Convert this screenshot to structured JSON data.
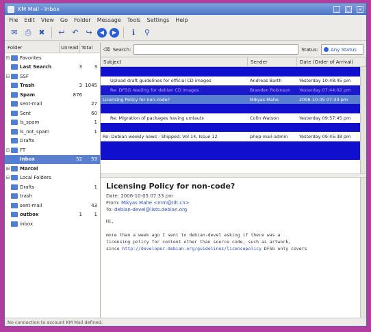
{
  "window": {
    "title": "KM Mail - Inbox"
  },
  "menu": [
    "File",
    "Edit",
    "View",
    "Go",
    "Folder",
    "Message",
    "Tools",
    "Settings",
    "Help"
  ],
  "toolbar": {
    "icons": [
      "new-message-icon",
      "print-icon",
      "trash-icon",
      "reply-icon",
      "reply-all-icon",
      "forward-icon",
      "previous-icon",
      "next-icon",
      "info-icon",
      "find-icon"
    ]
  },
  "folder_pane": {
    "headers": {
      "name": "Folder",
      "unread": "Unread",
      "total": "Total"
    },
    "items": [
      {
        "name": "Favorites",
        "unread": "",
        "total": ""
      },
      {
        "name": "Last Search",
        "unread": "3",
        "total": "3"
      },
      {
        "name": "SSF",
        "unread": "",
        "total": ""
      },
      {
        "name": "Trash",
        "unread": "3",
        "total": "1045"
      },
      {
        "name": "Spam",
        "unread": "876",
        "total": ""
      },
      {
        "name": "sent-mail",
        "unread": "",
        "total": "27"
      },
      {
        "name": "Sent",
        "unread": "",
        "total": "60"
      },
      {
        "name": "ls_spam",
        "unread": "",
        "total": "1"
      },
      {
        "name": "ls_not_spam",
        "unread": "",
        "total": "1"
      },
      {
        "name": "Drafts",
        "unread": "",
        "total": ""
      },
      {
        "name": "FT",
        "unread": "",
        "total": ""
      },
      {
        "name": "Inbox",
        "unread": "52",
        "total": "53"
      },
      {
        "name": "Marcel",
        "unread": "",
        "total": ""
      },
      {
        "name": "Local Folders",
        "unread": "",
        "total": ""
      },
      {
        "name": "Drafts",
        "unread": "",
        "total": "1"
      },
      {
        "name": "trash",
        "unread": "",
        "total": ""
      },
      {
        "name": "sent-mail",
        "unread": "",
        "total": "43"
      },
      {
        "name": "outbox",
        "unread": "1",
        "total": "1"
      },
      {
        "name": "inbox",
        "unread": "",
        "total": ""
      }
    ]
  },
  "search": {
    "label": "Search:",
    "status_label": "Status:",
    "status_value": "Any Status"
  },
  "message_list": {
    "headers": {
      "subject": "Subject",
      "sender": "Sender",
      "date": "Date (Order of Arrival)"
    },
    "rows": [
      {
        "subject": "",
        "sender": "",
        "date": "",
        "style": "thread"
      },
      {
        "subject": "Upload draft guidelines for official CD images",
        "sender": "Andreas Barth",
        "date": "Yesterday 10:48:45 pm",
        "style": "plain"
      },
      {
        "subject": "Re: DFSG reading for debian CD images",
        "sender": "Branden Robinson",
        "date": "Yesterday 07:44:02 pm",
        "style": "dark"
      },
      {
        "subject": "Licensing Policy for non-code?",
        "sender": "Mikyas Mahe",
        "date": "2006-10-05 07:33 pm",
        "style": "sel"
      },
      {
        "subject": "",
        "sender": "",
        "date": "",
        "style": "thread"
      },
      {
        "subject": "Re: Migration of packages having umlauts",
        "sender": "Colin Watson",
        "date": "Yesterday 09:57:45 pm",
        "style": "plain"
      },
      {
        "subject": "",
        "sender": "",
        "date": "",
        "style": "thread"
      },
      {
        "subject": "Re: Debian weekly news - Shipped, Vol 14, Issue 12",
        "sender": "phep-mail-admin",
        "date": "Yesterday 09:45:38 pm",
        "style": "plain"
      },
      {
        "subject": "",
        "sender": "",
        "date": "",
        "style": "thread"
      },
      {
        "subject": "",
        "sender": "",
        "date": "",
        "style": "thread"
      }
    ]
  },
  "preview": {
    "subject": "Licensing Policy for non-code?",
    "date_label": "Date:",
    "date": "2006-10-05 07:33 pm",
    "from_label": "From:",
    "from": "Mikyas Mahe <mm@tilt.cn>",
    "to_label": "To:",
    "to": "debian-devel@lists.debian.org",
    "greeting": "Hi,",
    "line1": "more than a week ago I sent to debian-devel asking if there was a",
    "line2": "licensing policy for content other than source code, such as artwork,",
    "line3_a": "since",
    "line3_link": "http://developer.debian.org/guidelines/licensepolicy",
    "line3_b": "DFSG only covers"
  },
  "status_bar": {
    "text": "No connection to account KM Mail defined."
  }
}
